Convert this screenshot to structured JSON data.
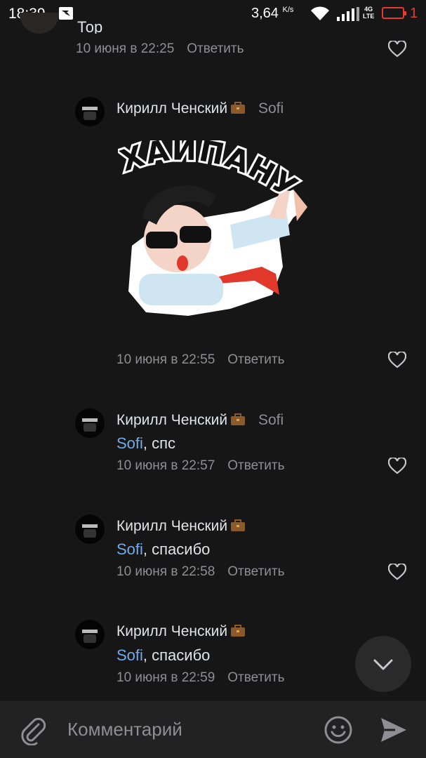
{
  "status_bar": {
    "time": "18:39",
    "speed_value": "3,64",
    "speed_unit": "K/s",
    "network": "4G",
    "network_sub": "LTE",
    "battery": "1"
  },
  "comments": [
    {
      "partial_text": "Тор",
      "date": "10 июня в 22:25",
      "reply_label": "Ответить"
    },
    {
      "author": "Кирилл Ченский",
      "reply_to": "Sofi",
      "sticker_text": "ХАЙПАНУЛ",
      "date": "10 июня в 22:55",
      "reply_label": "Ответить"
    },
    {
      "author": "Кирилл Ченский",
      "reply_to": "Sofi",
      "mention": "Sofi",
      "text": ", спс",
      "date": "10 июня в 22:57",
      "reply_label": "Ответить"
    },
    {
      "author": "Кирилл Ченский",
      "mention": "Sofi",
      "text": ", спасибо",
      "date": "10 июня в 22:58",
      "reply_label": "Ответить"
    },
    {
      "author": "Кирилл Ченский",
      "mention": "Sofi",
      "text": ", спасибо",
      "date": "10 июня в 22:59",
      "reply_label": "Ответить"
    }
  ],
  "composer": {
    "placeholder": "Комментарий",
    "attach_icon": "paperclip-icon",
    "emoji_icon": "smile-icon",
    "send_icon": "send-icon"
  },
  "colors": {
    "background": "#161616",
    "link": "#71aaeb",
    "secondary_text": "#8e8e93",
    "battery_low": "#e53a2f"
  }
}
